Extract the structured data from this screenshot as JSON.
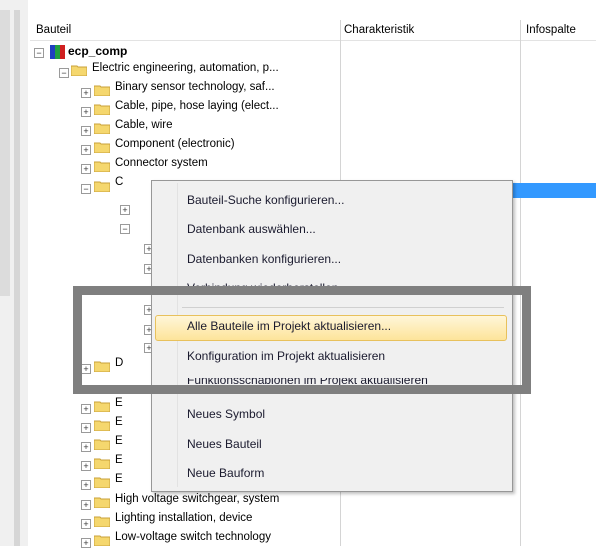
{
  "columns": {
    "bauteil": "Bauteil",
    "charakteristik": "Charakteristik",
    "infospalte": "Infospalte"
  },
  "tree": {
    "root": "ecp_comp",
    "level1": "Electric engineering, automation, p...",
    "items": [
      "Binary sensor technology, saf...",
      "Cable, pipe, hose laying (elect...",
      "Cable, wire",
      "Component (electronic)",
      "Connector system",
      "C"
    ],
    "partial": [
      "D",
      "E",
      "E",
      "E",
      "E",
      "E"
    ],
    "bottom": [
      "High voltage switchgear, system",
      "Lighting installation, device",
      "Low-voltage switch technology"
    ]
  },
  "context_menu": [
    "Bauteil-Suche konfigurieren...",
    "Datenbank auswählen...",
    "Datenbanken konfigurieren...",
    "Verbindung wiederherstellen",
    "Alle Bauteile im Projekt aktualisieren...",
    "Konfiguration im Projekt aktualisieren",
    "Funktionsschablonen im Projekt aktualisieren",
    "Neues Symbol",
    "Neues Bauteil",
    "Neue Bauform"
  ],
  "colors": {
    "selection": "#3399ff",
    "highlight": "#fde49a",
    "frame": "#7f7f7f",
    "folder": "#f5d76e"
  }
}
